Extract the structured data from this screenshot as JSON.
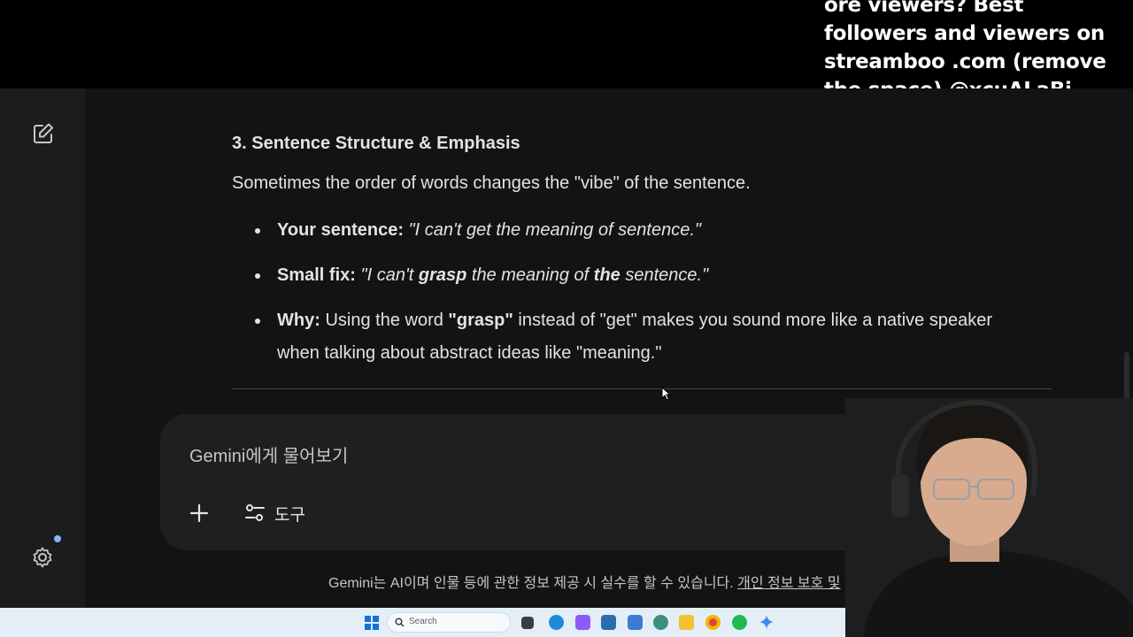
{
  "overlay": {
    "text": "ore viewers? Best followers and viewers on streamboo .com (remove the space) @xcuALaBi"
  },
  "sidebar": {
    "new_chat_icon": "edit-square-icon",
    "settings_icon": "gear-icon"
  },
  "response": {
    "heading": "3. Sentence Structure & Emphasis",
    "intro": "Sometimes the order of words changes the \"vibe\" of the sentence.",
    "bullets": [
      {
        "label": "Your sentence:",
        "parts": [
          "\"I can't get the meaning of sentence.\""
        ]
      },
      {
        "label": "Small fix:",
        "parts": [
          "\"I can't ",
          "grasp",
          " the meaning of ",
          "the",
          " sentence.\""
        ]
      },
      {
        "label": "Why:",
        "parts": [
          " Using the word ",
          "\"grasp\"",
          " instead of \"get\" makes you sound more like a native speaker when talking about abstract ideas like \"meaning.\""
        ]
      }
    ]
  },
  "input": {
    "placeholder": "Gemini에게 물어보기",
    "plus_icon": "plus-icon",
    "tools_label": "도구",
    "tools_icon": "sliders-icon",
    "mic_icon": "microphone-icon"
  },
  "footer": {
    "disclaimer": "Gemini는 AI이며 인물 등에 관한 정보 제공 시 실수를 할 수 있습니다.",
    "privacy_link": "개인 정보 보호 및"
  },
  "taskbar": {
    "search_label": "Search",
    "colors": {
      "windows": "#0a74da",
      "edge": "#1f8ad8",
      "chrome": "#db4437",
      "spotify": "#1db954",
      "explorer": "#f2c230"
    }
  },
  "colors": {
    "background": "#131314",
    "sidebar": "#1b1c1d",
    "input_box": "#1e1f20",
    "text": "#e3e3e3",
    "accent_dot": "#8ab4f8"
  }
}
